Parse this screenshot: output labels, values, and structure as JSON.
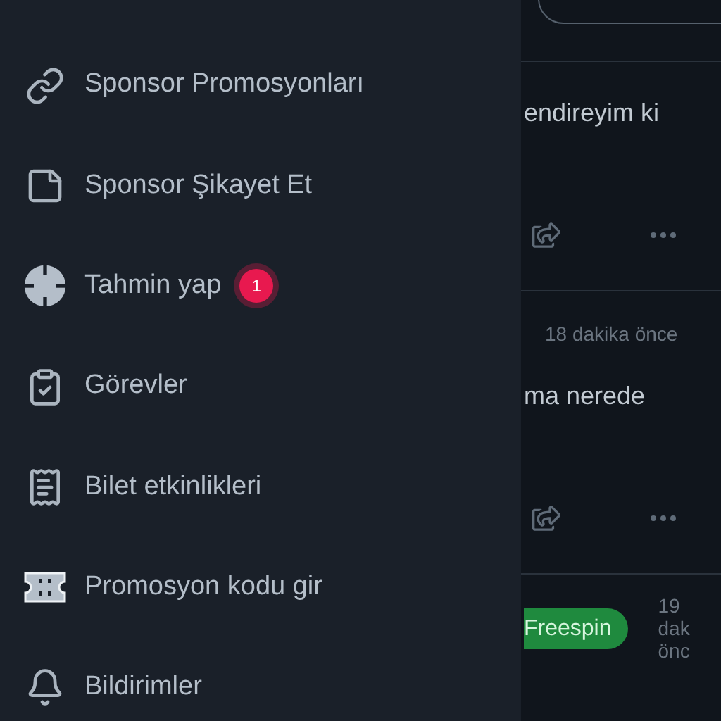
{
  "sidebar": {
    "items": [
      {
        "label": "Sponsor Promosyonları"
      },
      {
        "label": "Sponsor Şikayet Et"
      },
      {
        "label": "Tahmin yap",
        "badge": "1"
      },
      {
        "label": "Görevler"
      },
      {
        "label": "Bilet etkinlikleri"
      },
      {
        "label": "Promosyon kodu gir"
      },
      {
        "label": "Bildirimler"
      }
    ]
  },
  "feed": {
    "posts": [
      {
        "kind": "post",
        "text": "endireyim ki"
      },
      {
        "kind": "post",
        "time": "18 dakika önce",
        "text": "ma nerede"
      },
      {
        "kind": "promo",
        "tag": "Freespin",
        "time_lines": [
          "19",
          "dak",
          "önc"
        ]
      }
    ]
  }
}
